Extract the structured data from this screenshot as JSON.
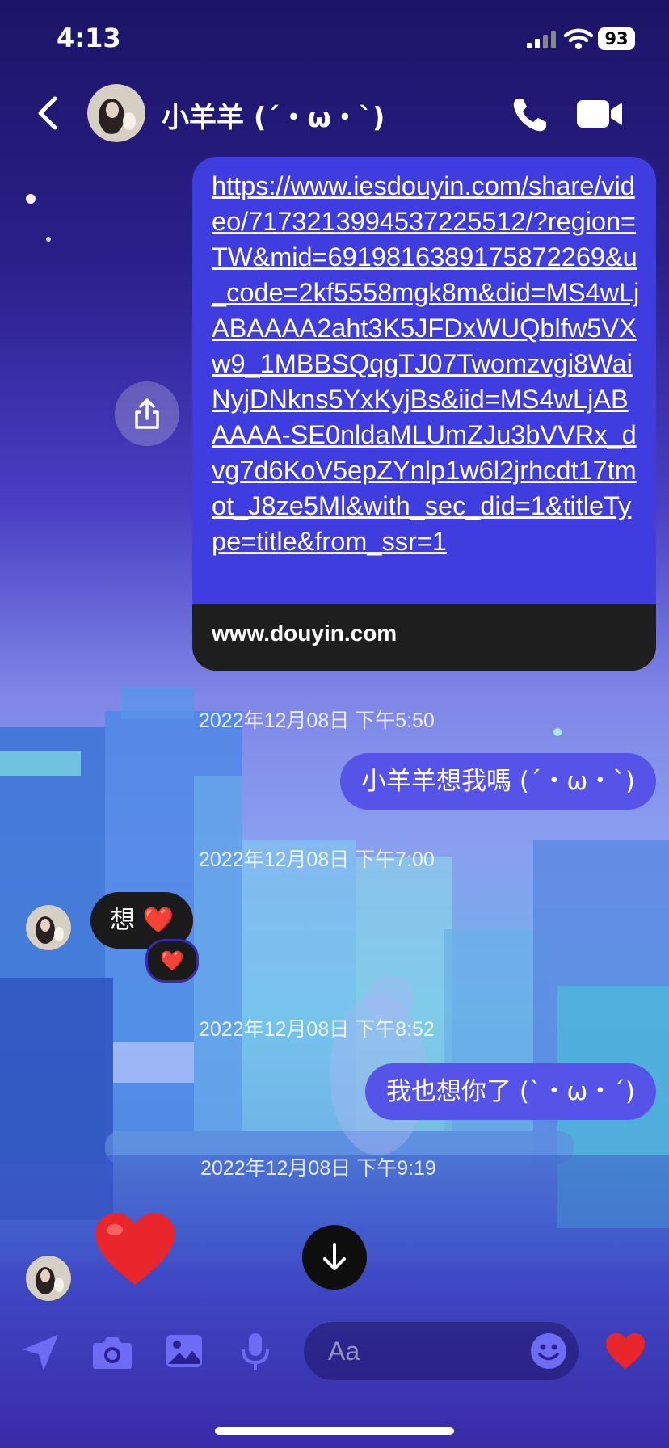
{
  "status_bar": {
    "time": "4:13",
    "battery": "93"
  },
  "header": {
    "contact_name": "小羊羊 (´・ω・`)"
  },
  "messages": {
    "link": {
      "url": "https://www.iesdouyin.com/share/video/7173213994537225512/?region=TW&mid=6919816389175872269&u_code=2kf5558mgk8m&did=MS4wLjABAAAA2aht3K5JFDxWUQblfw5VXw9_1MBBSQqgTJ07Twomzvgi8WaiNyjDNkns5YxKyjBs&iid=MS4wLjABAAAA-SE0nldaMLUmZJu3bVVRx_dvg7d6KoV5epZYnlp1w6l2jrhcdt17tmot_J8ze5Ml&with_sec_did=1&titleType=title&from_ssr=1",
      "domain": "www.douyin.com"
    },
    "timestamp_1": "2022年12月08日 下午5:50",
    "outgoing_1": "小羊羊想我嗎 (´・ω・`)",
    "timestamp_2": "2022年12月08日 下午7:00",
    "incoming_1": "想 ❤️",
    "reaction": "❤️",
    "timestamp_3": "2022年12月08日 下午8:52",
    "outgoing_2": "我也想你了 (`・ω・´)",
    "timestamp_4": "2022年12月08日 下午9:19"
  },
  "composer": {
    "placeholder": "Aa"
  },
  "colors": {
    "accent": "#5553e8",
    "link_bubble": "#3f3de0",
    "heart": "#e8262c"
  }
}
